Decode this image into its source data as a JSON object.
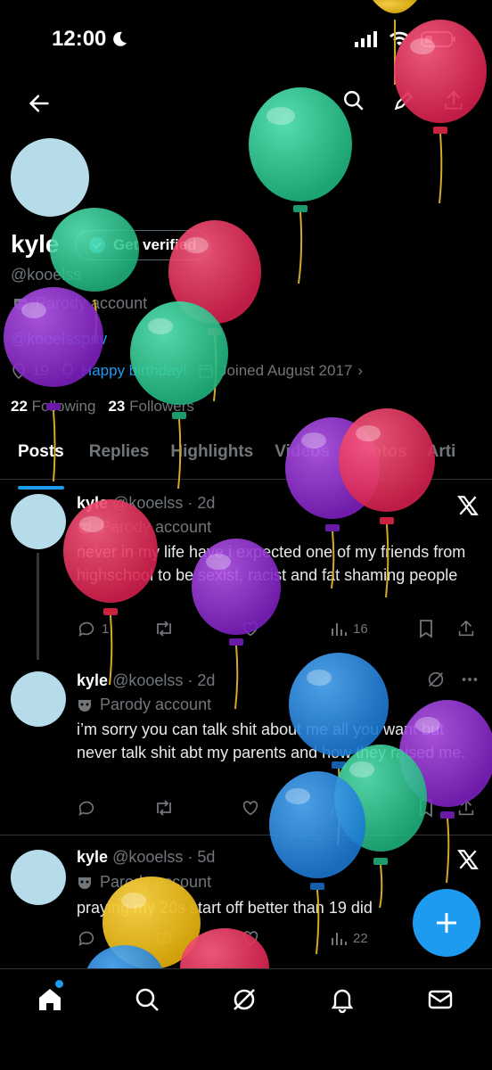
{
  "status_bar": {
    "time": "12:00"
  },
  "profile": {
    "name": "kyle",
    "verify_label": "Get verified",
    "handle": "@kooelss",
    "parody_label": "Parody account",
    "bio_link": "@kooelsspriv",
    "location": "19",
    "birthday": "Happy birthday!",
    "joined": "Joined August 2017",
    "following_count": "22",
    "following_label": "Following",
    "followers_count": "23",
    "followers_label": "Followers"
  },
  "tabs": [
    "Posts",
    "Replies",
    "Highlights",
    "Videos",
    "Photos",
    "Arti"
  ],
  "posts": [
    {
      "name": "kyle",
      "handle": "@kooelss",
      "time": "· 2d",
      "parody": "Parody account",
      "text": "never in my life have i expected one of my friends from highschool to be sexist, racist and fat shaming people",
      "replies": "1",
      "views": "16"
    },
    {
      "name": "kyle",
      "handle": "@kooelss",
      "time": "· 2d",
      "parody": "Parody account",
      "text": "i’m sorry you can talk shit about me all you want but never talk shit abt my parents and how they raised me.",
      "replies": "",
      "views": ""
    },
    {
      "name": "kyle",
      "handle": "@kooelss",
      "time": "· 5d",
      "parody": "Parody account",
      "text": "praying my 20s start off better than 19 did",
      "replies": "",
      "views": "22"
    }
  ],
  "colors": {
    "accent": "#1d9bf0",
    "balloon_green": "#2bd497",
    "balloon_red": "#e8375f",
    "balloon_purple": "#9b36d6",
    "balloon_blue": "#2f94e6",
    "balloon_yellow": "#f0c020"
  },
  "icons": [
    "back-arrow-icon",
    "search-icon",
    "edit-icon",
    "share-icon",
    "verified-badge-icon",
    "parody-mask-icon",
    "location-icon",
    "balloon-icon",
    "calendar-icon",
    "x-logo-icon",
    "reply-icon",
    "retweet-icon",
    "like-icon",
    "views-icon",
    "bookmark-icon",
    "grok-icon",
    "more-icon",
    "home-icon",
    "notifications-icon",
    "messages-icon",
    "plus-icon"
  ]
}
